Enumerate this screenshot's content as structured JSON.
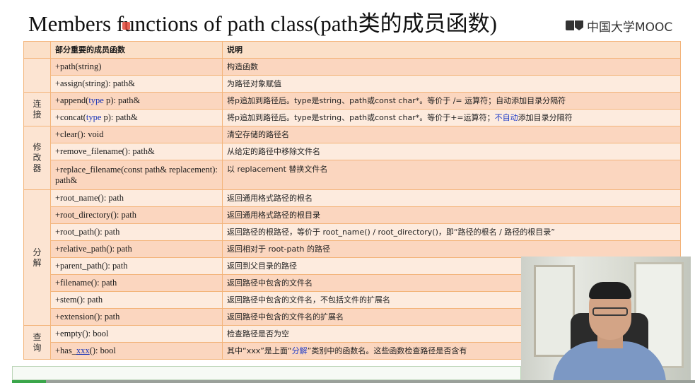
{
  "slide": {
    "title": "Members functions of path class(path类的成员函数)",
    "brand": "中国大学MOOC"
  },
  "table": {
    "headers": [
      "部分重要的成员函数",
      "说明"
    ],
    "groups": [
      "连接",
      "修改器",
      "分解",
      "查询"
    ],
    "rows": [
      {
        "fn": "+path(string)",
        "desc": "构造函数"
      },
      {
        "fn": "+assign(string): path&",
        "desc": "为路径对象赋值"
      },
      {
        "fn_pre": "+append(",
        "fn_kw": "type",
        "fn_post": " p): path&",
        "desc": "将p追加到路径后。type是string、path或const char*。等价于 /= 运算符；自动添加目录分隔符"
      },
      {
        "fn_pre": "+concat(",
        "fn_kw": "type",
        "fn_post": " p): path&",
        "desc_pre": "将p追加到路径后。type是string、path或const char*。等价于+=运算符；",
        "desc_hl": "不自动",
        "desc_post": "添加目录分隔符"
      },
      {
        "fn": "+clear(): void",
        "desc": "清空存储的路径名"
      },
      {
        "fn": "+remove_filename(): path&",
        "desc": "从给定的路径中移除文件名"
      },
      {
        "fn": "+replace_filename(const path& replacement): path&",
        "desc": "以 replacement 替换文件名"
      },
      {
        "fn": "+root_name(): path",
        "desc": "返回通用格式路径的根名"
      },
      {
        "fn": "+root_directory(): path",
        "desc": "返回通用格式路径的根目录"
      },
      {
        "fn": "+root_path(): path",
        "desc": "返回路径的根路径，等价于 root_name() / root_directory()，即“路径的根名 / 路径的根目录”"
      },
      {
        "fn": "+relative_path(): path",
        "desc": "返回相对于 root-path 的路径"
      },
      {
        "fn": "+parent_path(): path",
        "desc": "返回到父目录的路径"
      },
      {
        "fn": "+filename(): path",
        "desc": "返回路径中包含的文件名"
      },
      {
        "fn": "+stem(): path",
        "desc": "返回路径中包含的文件名，不包括文件的扩展名"
      },
      {
        "fn": "+extension(): path",
        "desc": "返回路径中包含的文件名的扩展名"
      },
      {
        "fn": "+empty(): bool",
        "desc": "检查路径是否为空"
      },
      {
        "fn_pre": "+has_",
        "fn_kw": "xxx",
        "fn_post": "(): bool",
        "desc_pre": "其中“xxx”是上面“",
        "desc_hl": "分解",
        "desc_post": "”类别中的函数名。这些函数检查路径是否含有"
      }
    ]
  },
  "player": {
    "progress": 0.05
  },
  "colors": {
    "header_bg": "#fbe0c8",
    "row_dark": "#fbd6bf",
    "row_light": "#fdebde",
    "border": "#f3b47a",
    "keyword_blue": "#1a35b8",
    "progress_green": "#3aa64a"
  }
}
